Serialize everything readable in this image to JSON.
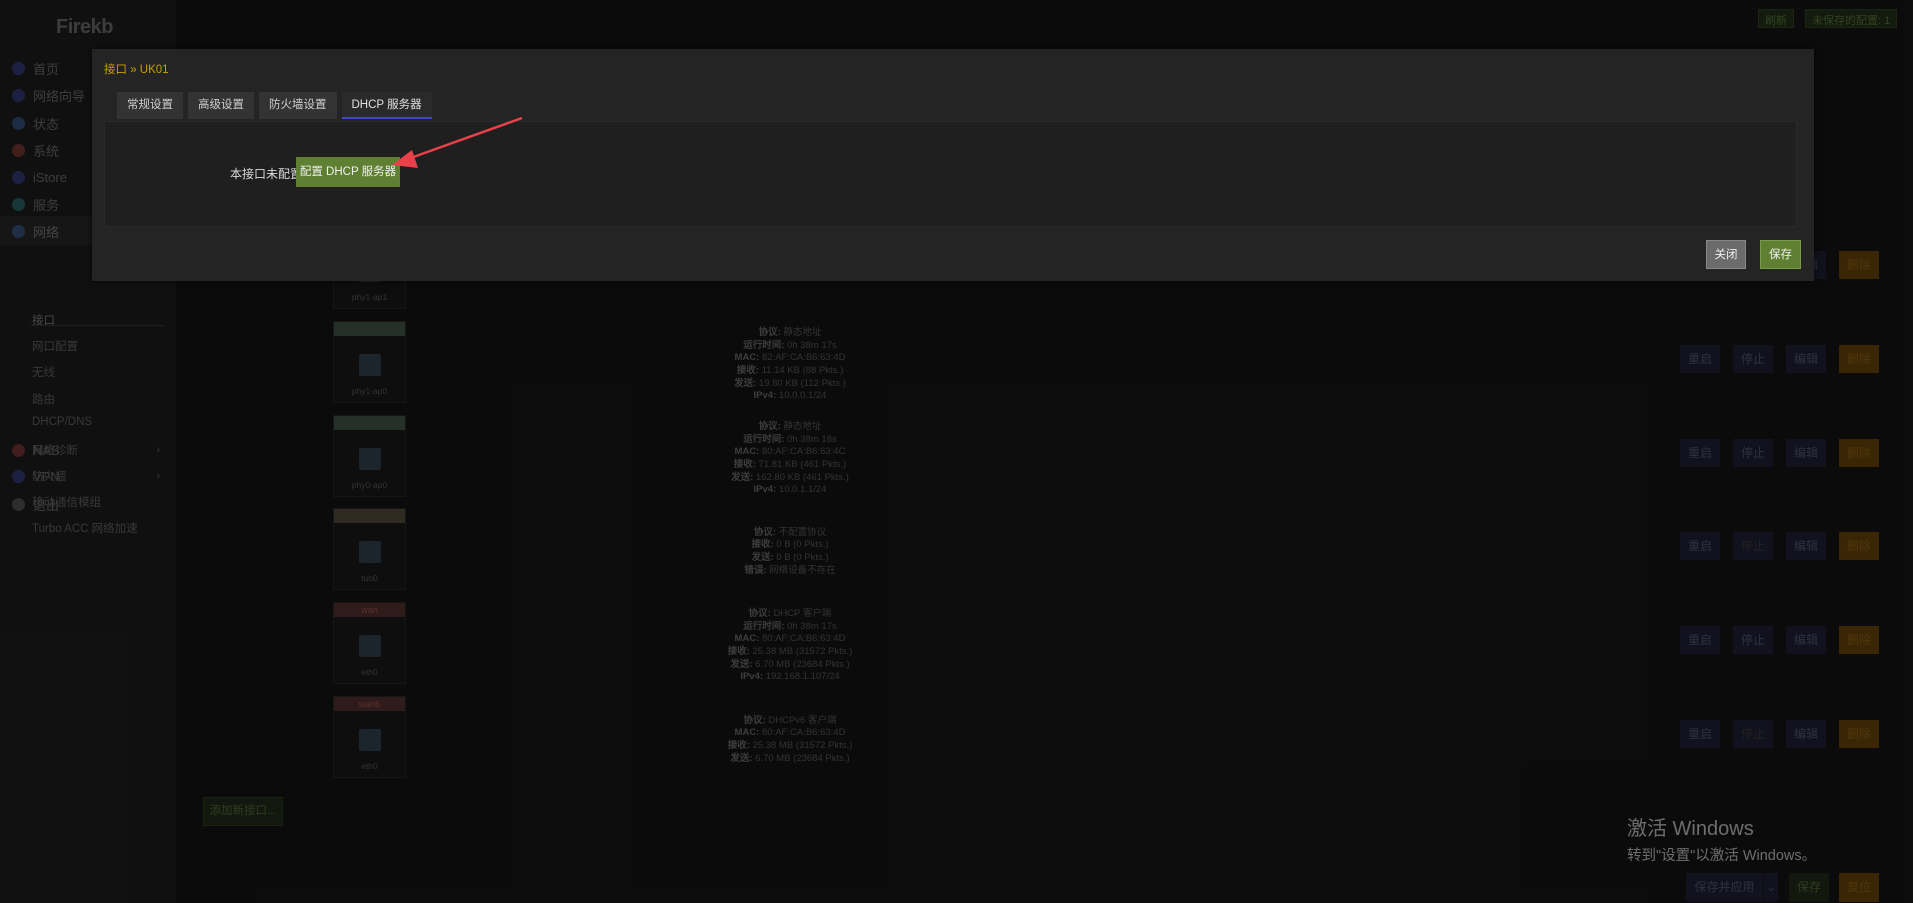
{
  "sidebar": {
    "logo": "Firekb",
    "items": [
      {
        "label": "首页",
        "icon": "home-icon",
        "color": "#3b4aa8"
      },
      {
        "label": "网络向导",
        "icon": "wizard-icon",
        "color": "#3b4aa8"
      },
      {
        "label": "状态",
        "icon": "status-grid-icon",
        "color": "#3b6aa8"
      },
      {
        "label": "系统",
        "icon": "gear-icon",
        "color": "#a8443b"
      },
      {
        "label": "iStore",
        "icon": "store-icon",
        "color": "#3b4aa8"
      },
      {
        "label": "服务",
        "icon": "link-icon",
        "color": "#2b8a8a"
      },
      {
        "label": "网络",
        "icon": "network-icon",
        "color": "#3b6aa8"
      },
      {
        "label": "NAS",
        "icon": "database-icon",
        "color": "#a83b3b"
      },
      {
        "label": "VPN",
        "icon": "vpn-icon",
        "color": "#3b4aa8"
      },
      {
        "label": "退出",
        "icon": "logout-icon",
        "color": "#6a6a6a"
      }
    ],
    "network_sub": [
      "接口",
      "网口配置",
      "无线",
      "路由",
      "DHCP/DNS",
      "网络诊断",
      "防火墙",
      "移动通信模组",
      "Turbo ACC 网络加速"
    ]
  },
  "topbar": {
    "refresh": "刷新",
    "unsaved": "未保存的配置: 1"
  },
  "interfaces": [
    {
      "header": "",
      "name": "phy1-ap1",
      "stats": []
    },
    {
      "header": "",
      "name": "phy1-ap0",
      "stats": [
        [
          "协议:",
          "静态地址"
        ],
        [
          "运行时间:",
          "0h 38m 17s"
        ],
        [
          "MAC:",
          "82:AF:CA:B6:63:4D"
        ],
        [
          "接收:",
          "11.14 KB (88 Pkts.)"
        ],
        [
          "发送:",
          "19.80 KB (112 Pkts.)"
        ],
        [
          "IPv4:",
          "10.0.0.1/24"
        ]
      ]
    },
    {
      "header": "",
      "name": "phy0-ap0",
      "stats": [
        [
          "协议:",
          "静态地址"
        ],
        [
          "运行时间:",
          "0h 38m 18s"
        ],
        [
          "MAC:",
          "80:AF:CA:B6:63:4C"
        ],
        [
          "接收:",
          "71.81 KB (461 Pkts.)"
        ],
        [
          "发送:",
          "162.80 KB (461 Pkts.)"
        ],
        [
          "IPv4:",
          "10.0.1.1/24"
        ]
      ]
    },
    {
      "header": "",
      "name": "tun0",
      "stats": [
        [
          "协议:",
          "不配置协议"
        ],
        [
          "接收:",
          "0 B (0 Pkts.)"
        ],
        [
          "发送:",
          "0 B (0 Pkts.)"
        ],
        [
          "错误:",
          "网络设备不存在"
        ]
      ]
    },
    {
      "header": "wan",
      "name": "eth0",
      "stats": [
        [
          "协议:",
          "DHCP 客户端"
        ],
        [
          "运行时间:",
          "0h 38m 17s"
        ],
        [
          "MAC:",
          "80:AF:CA:B6:63:4D"
        ],
        [
          "接收:",
          "25.38 MB (31572 Pkts.)"
        ],
        [
          "发送:",
          "6.70 MB (23684 Pkts.)"
        ],
        [
          "IPv4:",
          "192.168.1.107/24"
        ]
      ]
    },
    {
      "header": "wan6",
      "name": "eth0",
      "stats": [
        [
          "协议:",
          "DHCPv6 客户端"
        ],
        [
          "MAC:",
          "80:AF:CA:B6:63:4D"
        ],
        [
          "接收:",
          "25.38 MB (31572 Pkts.)"
        ],
        [
          "发送:",
          "6.70 MB (23684 Pkts.)"
        ]
      ]
    }
  ],
  "row_actions": {
    "restart": "重启",
    "stop": "停止",
    "edit": "编辑",
    "delete": "删除"
  },
  "add_interface": "添加新接口...",
  "watermark": {
    "line1": "激活 Windows",
    "line2": "转到\"设置\"以激活 Windows。"
  },
  "bottom": {
    "save_apply": "保存并应用",
    "save": "保存",
    "reset": "复位"
  },
  "modal": {
    "title": "接口 » UK01",
    "tabs": [
      "常规设置",
      "高级设置",
      "防火墙设置",
      "DHCP 服务器"
    ],
    "active_tab": "DHCP 服务器",
    "notice": "本接口未配置 DHCP 服务器",
    "configure_button": "配置 DHCP 服务器",
    "close": "关闭",
    "save": "保存"
  },
  "colors": {
    "accent_green": "#5f7f32",
    "title_gold": "#c7a100",
    "arrow_red": "#e8414a",
    "tab_underline": "#3f49c8"
  }
}
